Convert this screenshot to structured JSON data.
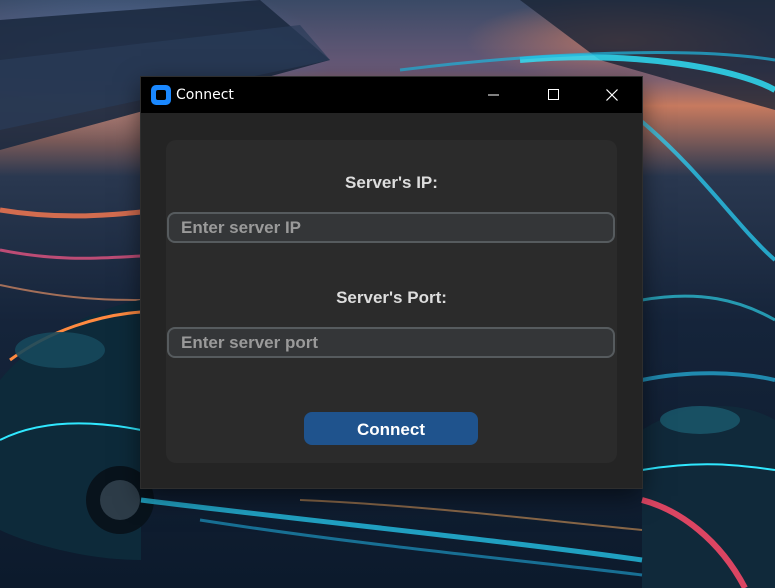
{
  "colors": {
    "titlebar": "#000000",
    "window_bg": "#242424",
    "panel_bg": "#2b2b2b",
    "entry_bg": "#343638",
    "entry_border": "#565b5e",
    "button": "#1f538d",
    "app_icon": "#1a88ff"
  },
  "window": {
    "title": "Connect",
    "icon": "app-icon",
    "controls": [
      "minimize-icon",
      "maximize-icon",
      "close-icon"
    ]
  },
  "form": {
    "ip_label": "Server's IP:",
    "ip_placeholder": "Enter server IP",
    "ip_value": "",
    "port_label": "Server's Port:",
    "port_placeholder": "Enter server port",
    "port_value": "",
    "connect_label": "Connect"
  }
}
